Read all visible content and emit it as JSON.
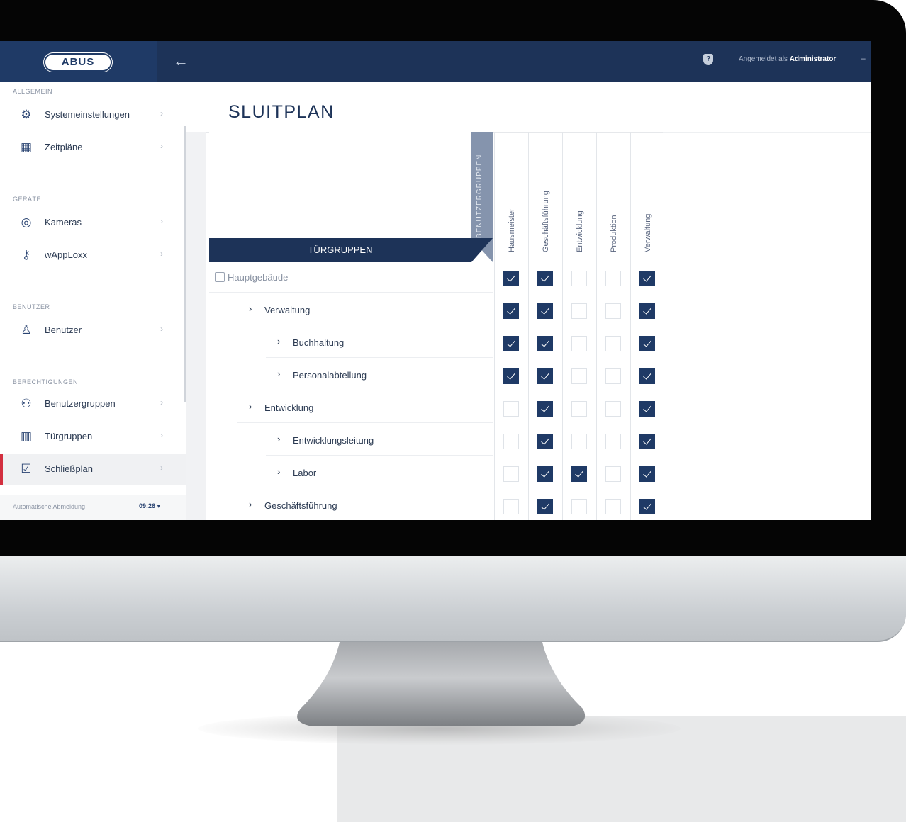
{
  "topbar": {
    "logo": "ABUS",
    "back_icon": "arrow-left-icon",
    "login_prefix": "Angemeldet als",
    "login_user": "Administrator"
  },
  "sidebar": {
    "sections": [
      "ALLGEMEIN",
      "GERÄTE",
      "BENUTZER",
      "BERECHTIGUNGEN"
    ],
    "items": [
      {
        "label": "Systemeinstellungen",
        "icon": "gear-icon"
      },
      {
        "label": "Zeitpläne",
        "icon": "calendar-icon"
      },
      {
        "label": "Kameras",
        "icon": "camera-icon"
      },
      {
        "label": "wAppLoxx",
        "icon": "key-icon"
      },
      {
        "label": "Benutzer",
        "icon": "user-icon"
      },
      {
        "label": "Benutzergruppen",
        "icon": "users-icon"
      },
      {
        "label": "Türgruppen",
        "icon": "door-icon"
      },
      {
        "label": "Schließplan",
        "icon": "checkbox-icon",
        "active": true
      }
    ],
    "auto_logout_label": "Automatische Abmeldung",
    "auto_logout_value": "09:26 ▾"
  },
  "page": {
    "title": "SLUITPLAN",
    "tuergruppen_label": "TÜRGRUPPEN",
    "benutzergruppen_label": "BENUTZERGRUPPEN"
  },
  "matrix": {
    "columns": [
      "Hausmeister",
      "Geschäftsführung",
      "Entwicklung",
      "Produktion",
      "Verwaltung"
    ],
    "rows": [
      {
        "label": "Hauptgebäude",
        "level": 0,
        "checks": [
          true,
          true,
          false,
          false,
          true
        ]
      },
      {
        "label": "Verwaltung",
        "level": 1,
        "checks": [
          true,
          true,
          false,
          false,
          true
        ]
      },
      {
        "label": "Buchhaltung",
        "level": 2,
        "checks": [
          true,
          true,
          false,
          false,
          true
        ]
      },
      {
        "label": "Personalabtellung",
        "level": 2,
        "checks": [
          true,
          true,
          false,
          false,
          true
        ]
      },
      {
        "label": "Entwicklung",
        "level": 1,
        "checks": [
          false,
          true,
          false,
          false,
          true
        ]
      },
      {
        "label": "Entwicklungsleitung",
        "level": 2,
        "checks": [
          false,
          true,
          false,
          false,
          true
        ]
      },
      {
        "label": "Labor",
        "level": 2,
        "checks": [
          false,
          true,
          true,
          false,
          true
        ]
      },
      {
        "label": "Geschäftsführung",
        "level": 1,
        "checks": [
          false,
          true,
          false,
          false,
          true
        ]
      }
    ]
  },
  "colors": {
    "navy": "#1d3358",
    "accent_red": "#d32f3f",
    "checked": "#1f3a66"
  }
}
